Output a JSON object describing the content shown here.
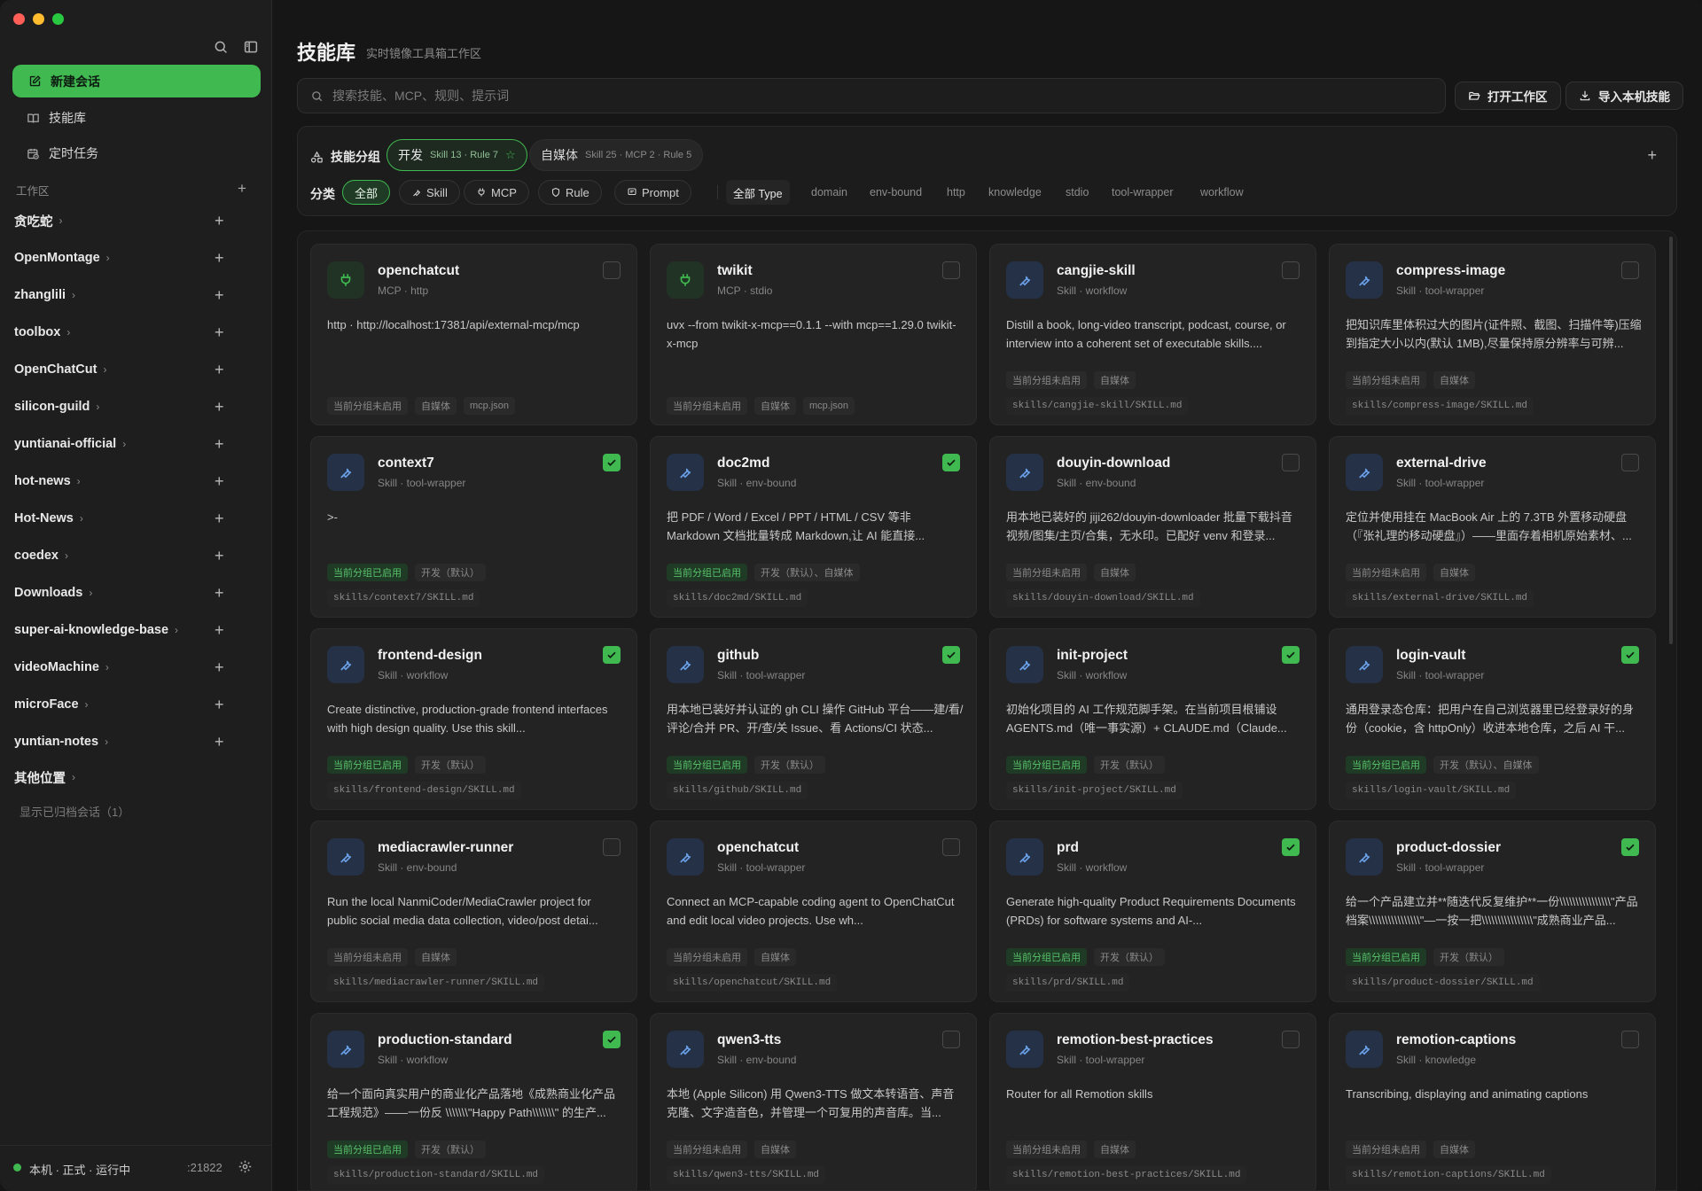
{
  "sidebar": {
    "new_chat": "新建会话",
    "nav": [
      {
        "label": "技能库",
        "icon": "book-icon"
      },
      {
        "label": "定时任务",
        "icon": "calendar-clock-icon"
      }
    ],
    "workspace_title": "工作区",
    "workspaces": [
      "贪吃蛇",
      "OpenMontage",
      "zhanglili",
      "toolbox",
      "OpenChatCut",
      "silicon-guild",
      "yuntianai-official",
      "hot-news",
      "Hot-News",
      "coedex",
      "Downloads",
      "super-ai-knowledge-base",
      "videoMachine",
      "microFace",
      "yuntian-notes"
    ],
    "other_locations": "其他位置",
    "archived": "显示已归档会话（1）",
    "status": "本机 · 正式 · 运行中",
    "port": ":21822"
  },
  "header": {
    "title": "技能库",
    "subtitle": "实时镜像工具箱工作区",
    "search_placeholder": "搜索技能、MCP、规则、提示词",
    "open_workspace": "打开工作区",
    "import_local": "导入本机技能"
  },
  "filters": {
    "group_label": "技能分组",
    "groups": [
      {
        "name": "开发",
        "meta": "Skill 13 · Rule 7",
        "active": true
      },
      {
        "name": "自媒体",
        "meta": "Skill 25 · MCP 2 · Rule 5",
        "active": false
      }
    ],
    "category_label": "分类",
    "categories": [
      {
        "label": "全部",
        "active": true
      },
      {
        "label": "Skill",
        "icon": "wrench-icon"
      },
      {
        "label": "MCP",
        "icon": "plug-icon"
      },
      {
        "label": "Rule",
        "icon": "shield-icon"
      },
      {
        "label": "Prompt",
        "icon": "message-icon"
      }
    ],
    "types": [
      "全部 Type",
      "domain",
      "env-bound",
      "http",
      "knowledge",
      "stdio",
      "tool-wrapper",
      "workflow"
    ]
  },
  "cards": [
    {
      "name": "openchatcut",
      "kind": "mcp",
      "type": "MCP · http",
      "checked": false,
      "desc": "http · http://localhost:17381/api/external-mcp/mcp",
      "tags": [
        {
          "t": "当前分组未启用",
          "on": false
        },
        {
          "t": "自媒体",
          "on": false
        },
        {
          "t": "mcp.json",
          "on": false
        }
      ],
      "path": ""
    },
    {
      "name": "twikit",
      "kind": "mcp",
      "type": "MCP · stdio",
      "checked": false,
      "desc": "uvx --from twikit-x-mcp==0.1.1 --with mcp==1.29.0 twikit-x-mcp",
      "tags": [
        {
          "t": "当前分组未启用",
          "on": false
        },
        {
          "t": "自媒体",
          "on": false
        },
        {
          "t": "mcp.json",
          "on": false
        }
      ],
      "path": ""
    },
    {
      "name": "cangjie-skill",
      "kind": "skill",
      "type": "Skill · workflow",
      "checked": false,
      "desc": "Distill a book, long-video transcript, podcast, course, or interview into a coherent set of executable skills....",
      "tags": [
        {
          "t": "当前分组未启用",
          "on": false
        },
        {
          "t": "自媒体",
          "on": false
        }
      ],
      "path": "skills/cangjie-skill/SKILL.md"
    },
    {
      "name": "compress-image",
      "kind": "skill",
      "type": "Skill · tool-wrapper",
      "checked": false,
      "desc": "把知识库里体积过大的图片(证件照、截图、扫描件等)压缩到指定大小以内(默认 1MB),尽量保持原分辨率与可辨...",
      "tags": [
        {
          "t": "当前分组未启用",
          "on": false
        },
        {
          "t": "自媒体",
          "on": false
        }
      ],
      "path": "skills/compress-image/SKILL.md"
    },
    {
      "name": "context7",
      "kind": "skill",
      "type": "Skill · tool-wrapper",
      "checked": true,
      "desc": ">-",
      "tags": [
        {
          "t": "当前分组已启用",
          "on": true
        },
        {
          "t": "开发（默认）",
          "on": false
        }
      ],
      "path": "skills/context7/SKILL.md"
    },
    {
      "name": "doc2md",
      "kind": "skill",
      "type": "Skill · env-bound",
      "checked": true,
      "desc": "把 PDF / Word / Excel / PPT / HTML / CSV 等非 Markdown 文档批量转成 Markdown,让 AI 能直接...",
      "tags": [
        {
          "t": "当前分组已启用",
          "on": true
        },
        {
          "t": "开发（默认）、自媒体",
          "on": false
        }
      ],
      "path": "skills/doc2md/SKILL.md"
    },
    {
      "name": "douyin-download",
      "kind": "skill",
      "type": "Skill · env-bound",
      "checked": false,
      "desc": "用本地已装好的 jiji262/douyin-downloader 批量下载抖音视频/图集/主页/合集，无水印。已配好 venv 和登录...",
      "tags": [
        {
          "t": "当前分组未启用",
          "on": false
        },
        {
          "t": "自媒体",
          "on": false
        }
      ],
      "path": "skills/douyin-download/SKILL.md"
    },
    {
      "name": "external-drive",
      "kind": "skill",
      "type": "Skill · tool-wrapper",
      "checked": false,
      "desc": "定位并使用挂在 MacBook Air 上的 7.3TB 外置移动硬盘（『张礼理的移动硬盘』）——里面存着相机原始素材、...",
      "tags": [
        {
          "t": "当前分组未启用",
          "on": false
        },
        {
          "t": "自媒体",
          "on": false
        }
      ],
      "path": "skills/external-drive/SKILL.md"
    },
    {
      "name": "frontend-design",
      "kind": "skill",
      "type": "Skill · workflow",
      "checked": true,
      "desc": "Create distinctive, production-grade frontend interfaces with high design quality. Use this skill...",
      "tags": [
        {
          "t": "当前分组已启用",
          "on": true
        },
        {
          "t": "开发（默认）",
          "on": false
        }
      ],
      "path": "skills/frontend-design/SKILL.md"
    },
    {
      "name": "github",
      "kind": "skill",
      "type": "Skill · tool-wrapper",
      "checked": true,
      "desc": "用本地已装好并认证的 gh CLI 操作 GitHub 平台——建/看/评论/合并 PR、开/查/关 Issue、看 Actions/CI 状态...",
      "tags": [
        {
          "t": "当前分组已启用",
          "on": true
        },
        {
          "t": "开发（默认）",
          "on": false
        }
      ],
      "path": "skills/github/SKILL.md"
    },
    {
      "name": "init-project",
      "kind": "skill",
      "type": "Skill · workflow",
      "checked": true,
      "desc": "初始化项目的 AI 工作规范脚手架。在当前项目根铺设 AGENTS.md（唯一事实源）+ CLAUDE.md（Claude...",
      "tags": [
        {
          "t": "当前分组已启用",
          "on": true
        },
        {
          "t": "开发（默认）",
          "on": false
        }
      ],
      "path": "skills/init-project/SKILL.md"
    },
    {
      "name": "login-vault",
      "kind": "skill",
      "type": "Skill · tool-wrapper",
      "checked": true,
      "desc": "通用登录态仓库：把用户在自己浏览器里已经登录好的身份（cookie，含 httpOnly）收进本地仓库，之后 AI 干...",
      "tags": [
        {
          "t": "当前分组已启用",
          "on": true
        },
        {
          "t": "开发（默认）、自媒体",
          "on": false
        }
      ],
      "path": "skills/login-vault/SKILL.md"
    },
    {
      "name": "mediacrawler-runner",
      "kind": "skill",
      "type": "Skill · env-bound",
      "checked": false,
      "desc": "Run the local NanmiCoder/MediaCrawler project for public social media data collection, video/post detai...",
      "tags": [
        {
          "t": "当前分组未启用",
          "on": false
        },
        {
          "t": "自媒体",
          "on": false
        }
      ],
      "path": "skills/mediacrawler-runner/SKILL.md"
    },
    {
      "name": "openchatcut",
      "kind": "skill",
      "type": "Skill · tool-wrapper",
      "checked": false,
      "desc": "Connect an MCP-capable coding agent to OpenChatCut and edit local video projects. Use wh...",
      "tags": [
        {
          "t": "当前分组未启用",
          "on": false
        },
        {
          "t": "自媒体",
          "on": false
        }
      ],
      "path": "skills/openchatcut/SKILL.md"
    },
    {
      "name": "prd",
      "kind": "skill",
      "type": "Skill · workflow",
      "checked": true,
      "desc": "Generate high-quality Product Requirements Documents (PRDs) for software systems and AI-...",
      "tags": [
        {
          "t": "当前分组已启用",
          "on": true
        },
        {
          "t": "开发（默认）",
          "on": false
        }
      ],
      "path": "skills/prd/SKILL.md"
    },
    {
      "name": "product-dossier",
      "kind": "skill",
      "type": "Skill · tool-wrapper",
      "checked": true,
      "desc": "给一个产品建立并**随迭代反复维护**一份\\\\\\\\\\\\\\\\\\\\\\\\\\\\\\\\\"产品档案\\\\\\\\\\\\\\\\\\\\\\\\\\\\\\\\\"—一按一把\\\\\\\\\\\\\\\\\\\\\\\\\\\\\\\\\"成熟商业产品...",
      "tags": [
        {
          "t": "当前分组已启用",
          "on": true
        },
        {
          "t": "开发（默认）",
          "on": false
        }
      ],
      "path": "skills/product-dossier/SKILL.md"
    },
    {
      "name": "production-standard",
      "kind": "skill",
      "type": "Skill · workflow",
      "checked": true,
      "desc": "给一个面向真实用户的商业化产品落地《成熟商业化产品工程规范》——一份反 \\\\\\\\\\\\\\\"Happy Path\\\\\\\\\\\\\\\" 的生产...",
      "tags": [
        {
          "t": "当前分组已启用",
          "on": true
        },
        {
          "t": "开发（默认）",
          "on": false
        }
      ],
      "path": "skills/production-standard/SKILL.md"
    },
    {
      "name": "qwen3-tts",
      "kind": "skill",
      "type": "Skill · env-bound",
      "checked": false,
      "desc": "本地 (Apple Silicon) 用 Qwen3-TTS 做文本转语音、声音克隆、文字造音色，并管理一个可复用的声音库。当...",
      "tags": [
        {
          "t": "当前分组未启用",
          "on": false
        },
        {
          "t": "自媒体",
          "on": false
        }
      ],
      "path": "skills/qwen3-tts/SKILL.md"
    },
    {
      "name": "remotion-best-practices",
      "kind": "skill",
      "type": "Skill · tool-wrapper",
      "checked": false,
      "desc": "Router for all Remotion skills",
      "tags": [
        {
          "t": "当前分组未启用",
          "on": false
        },
        {
          "t": "自媒体",
          "on": false
        }
      ],
      "path": "skills/remotion-best-practices/SKILL.md"
    },
    {
      "name": "remotion-captions",
      "kind": "skill",
      "type": "Skill · knowledge",
      "checked": false,
      "desc": "Transcribing, displaying and animating captions",
      "tags": [
        {
          "t": "当前分组未启用",
          "on": false
        },
        {
          "t": "自媒体",
          "on": false
        }
      ],
      "path": "skills/remotion-captions/SKILL.md"
    }
  ]
}
